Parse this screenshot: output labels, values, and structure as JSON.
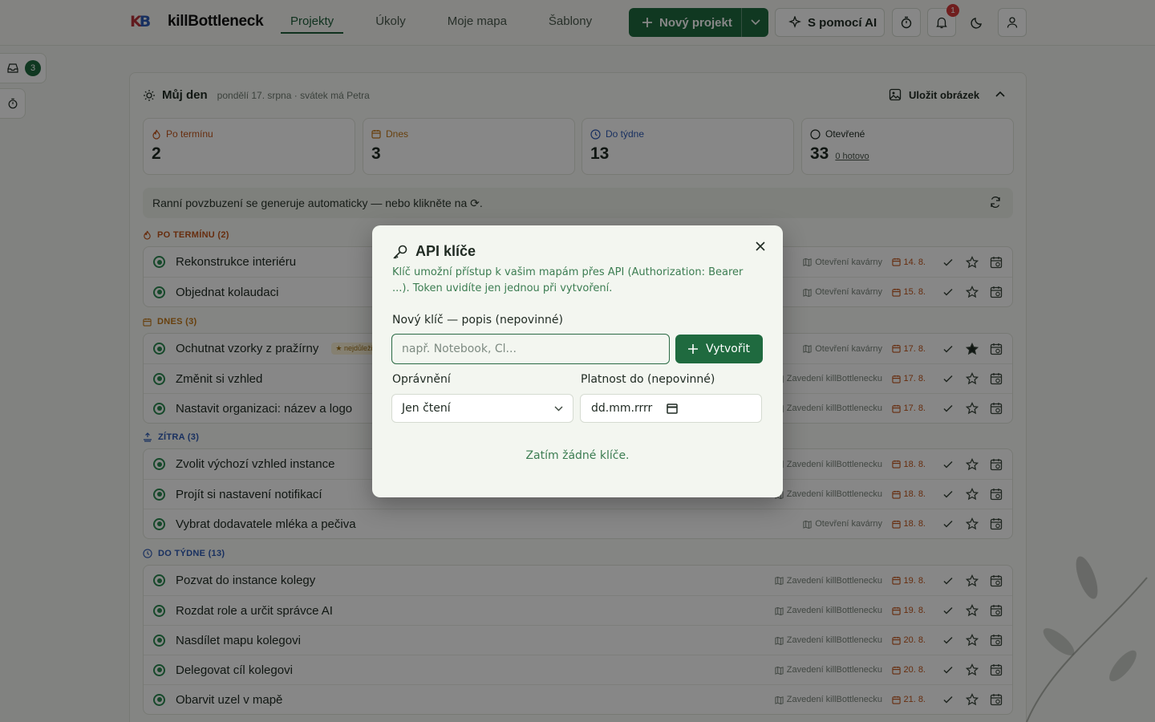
{
  "app": {
    "brand": "killBottleneck",
    "logo_letters": "KB"
  },
  "nav": {
    "items": [
      {
        "label": "Projekty"
      },
      {
        "label": "Úkoly"
      },
      {
        "label": "Moje mapa"
      },
      {
        "label": "Šablony"
      }
    ]
  },
  "header": {
    "new_project": "Nový projekt",
    "ai_button": "S pomocí AI",
    "notifications_count": "1"
  },
  "sidebar": {
    "inbox_count": "3"
  },
  "my_day": {
    "title": "Můj den",
    "subtitle": "pondělí 17. srpna · svátek má Petra",
    "save_image": "Uložit obrázek"
  },
  "stats": [
    {
      "label": "Po termínu",
      "value": "2",
      "color": "#c2561c"
    },
    {
      "label": "Dnes",
      "value": "3",
      "color": "#c47a1a"
    },
    {
      "label": "Do týdne",
      "value": "13",
      "color": "#2f5bb5"
    },
    {
      "label": "Otevřené",
      "value": "33",
      "link": "0 hotovo",
      "color": "#1f2a22"
    }
  ],
  "motivation": "Ranní povzbuzení se generuje automaticky — nebo klikněte na ⟳.",
  "sections": {
    "overdue": {
      "title": "PO TERMÍNU (2)",
      "color": "#c2561c",
      "tasks": [
        {
          "name": "Rekonstrukce interiéru",
          "project": "Otevření kavárny",
          "date": "14. 8."
        },
        {
          "name": "Objednat kolaudaci",
          "project": "Otevření kavárny",
          "date": "15. 8."
        }
      ]
    },
    "today": {
      "title": "DNES (3)",
      "color": "#c47a1a",
      "tasks": [
        {
          "name": "Ochutnat vzorky z pražírny",
          "tag": "★ nejdůležitější",
          "project": "Otevření kavárny",
          "date": "17. 8."
        },
        {
          "name": "Změnit si vzhled",
          "project": "Zavedení killBottlenecku",
          "date": "17. 8."
        },
        {
          "name": "Nastavit organizaci: název a logo",
          "project": "Zavedení killBottlenecku",
          "date": "17. 8."
        }
      ]
    },
    "tomorrow": {
      "title": "ZÍTRA (3)",
      "color": "#2f5bb5",
      "tasks": [
        {
          "name": "Zvolit výchozí vzhled instance",
          "project": "Zavedení killBottlenecku",
          "date": "18. 8."
        },
        {
          "name": "Projít si nastavení notifikací",
          "project": "Zavedení killBottlenecku",
          "date": "18. 8."
        },
        {
          "name": "Vybrat dodavatele mléka a pečiva",
          "project": "Otevření kavárny",
          "date": "18. 8."
        }
      ]
    },
    "week": {
      "title": "DO TÝDNE (13)",
      "color": "#2f5bb5",
      "tasks": [
        {
          "name": "Pozvat do instance kolegy",
          "project": "Zavedení killBottlenecku",
          "date": "19. 8."
        },
        {
          "name": "Rozdat role a určit správce AI",
          "project": "Zavedení killBottlenecku",
          "date": "19. 8."
        },
        {
          "name": "Nasdílet mapu kolegovi",
          "project": "Zavedení killBottlenecku",
          "date": "20. 8."
        },
        {
          "name": "Delegovat cíl kolegovi",
          "project": "Zavedení killBottlenecku",
          "date": "20. 8."
        },
        {
          "name": "Obarvit uzel v mapě",
          "project": "Zavedení killBottlenecku",
          "date": "21. 8."
        }
      ]
    }
  },
  "modal": {
    "title": "API klíče",
    "description": "Klíč umožní přístup k vašim mapám přes API (Authorization: Bearer ...). Token uvidíte jen jednou při vytvoření.",
    "new_key_label": "Nový klíč — popis (nepovinné)",
    "new_key_placeholder": "např. Notebook, Cl...",
    "create_button": "Vytvořit",
    "permissions_label": "Oprávnění",
    "permissions_value": "Jen čtení",
    "expiry_label": "Platnost do (nepovinné)",
    "expiry_placeholder": "dd.mm.rrrr",
    "empty_text": "Zatím žádné klíče."
  },
  "colors": {
    "accent": "#1f6a3f",
    "overdue": "#c2561c",
    "today": "#c47a1a",
    "week": "#2f5bb5"
  }
}
